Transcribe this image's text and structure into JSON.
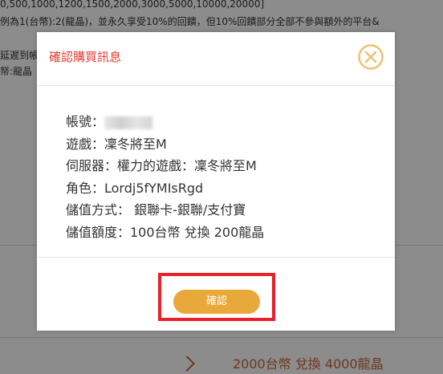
{
  "background": {
    "line1": "0,500,1000,1200,1500,2000,3000,5000,10000,20000]",
    "line2": "例為1(台幣):2(龍晶)，並永久享受10%的回饋，但10%回饋部分全部不參與額外的平台&",
    "line3": "延遲到帳",
    "line4": "帑:龍晶",
    "bottom_text": "2000台幣 兌換 4000龍晶"
  },
  "modal": {
    "title": "確認購買訊息",
    "rows": {
      "account_label": "帳號：",
      "game": "遊戲：凜冬將至M",
      "server": "伺服器：權力的遊戲：凜冬將至M",
      "role": "角色：Lordj5fYMIsRgd",
      "payment": "儲值方式： 銀聯卡-銀聯/支付寶",
      "amount": "儲值額度：100台幣 兌換 200龍晶"
    },
    "confirm_label": "確認"
  },
  "colors": {
    "title": "#e03b2f",
    "accent": "#e9a93a",
    "highlight": "#e8222a",
    "close_icon": "#f0c070"
  },
  "icons": {
    "close": "close-circle-icon",
    "chevron": "chevron-right-icon"
  }
}
